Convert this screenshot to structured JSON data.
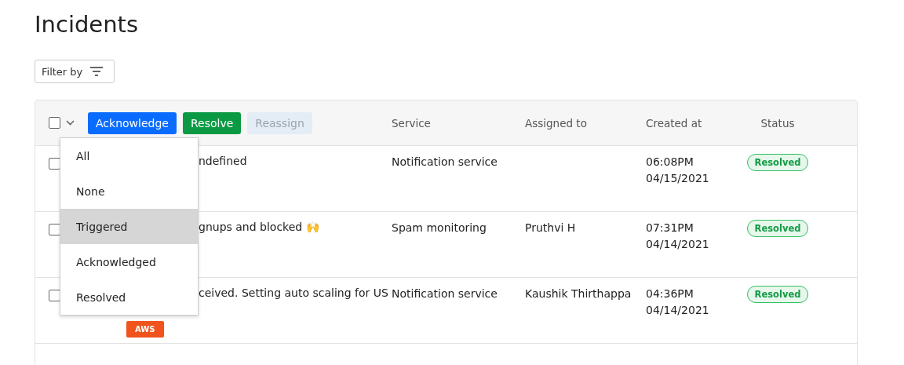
{
  "page": {
    "title": "Incidents"
  },
  "filter": {
    "label": "Filter by"
  },
  "table": {
    "select_all": {
      "checked": false
    },
    "bulk_actions": [
      {
        "label": "Acknowledge",
        "kind": "primary",
        "disabled": false
      },
      {
        "label": "Resolve",
        "kind": "success",
        "disabled": false
      },
      {
        "label": "Reassign",
        "kind": "neutral",
        "disabled": true
      }
    ],
    "columns": [
      "Service",
      "Assigned to",
      "Created at",
      "Status"
    ],
    "rows": [
      {
        "checked": false,
        "title": "ndefined",
        "tags": [],
        "service": "Notification service",
        "assignee": "",
        "time": "06:08PM",
        "date": "04/15/2021",
        "status": "Resolved"
      },
      {
        "checked": false,
        "title": "gnups and blocked 🙌",
        "tags": [],
        "service": "Spam monitoring",
        "assignee": "Pruthvi H",
        "time": "07:31PM",
        "date": "04/14/2021",
        "status": "Resolved"
      },
      {
        "checked": false,
        "title": "ceived. Setting auto scaling for US",
        "tags": [
          "AWS"
        ],
        "service": "Notification service",
        "assignee": "Kaushik Thirthappa",
        "time": "04:36PM",
        "date": "04/14/2021",
        "status": "Resolved"
      }
    ]
  },
  "select_menu": {
    "items": [
      {
        "label": "All",
        "selected": false
      },
      {
        "label": "None",
        "selected": false
      },
      {
        "label": "Triggered",
        "selected": true
      },
      {
        "label": "Acknowledged",
        "selected": false
      },
      {
        "label": "Resolved",
        "selected": false
      }
    ]
  }
}
